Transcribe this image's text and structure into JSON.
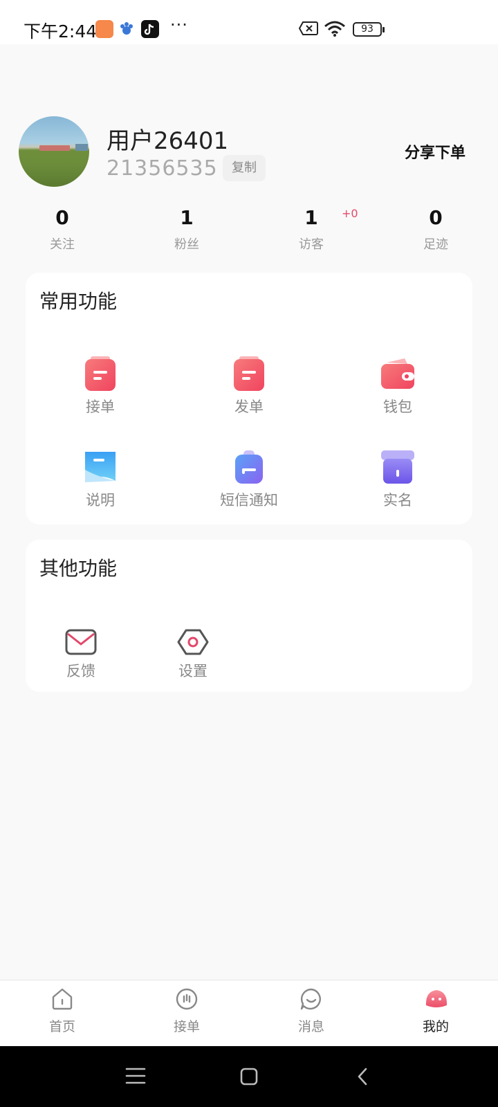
{
  "status_bar": {
    "time": "下午2:44",
    "battery": "93",
    "more_icon": "···"
  },
  "profile": {
    "username": "用户26401",
    "user_id": "21356535",
    "copy_label": "复制",
    "share_order_label": "分享下单"
  },
  "stats": [
    {
      "value": "0",
      "label": "关注"
    },
    {
      "value": "1",
      "label": "粉丝"
    },
    {
      "value": "1",
      "label": "访客",
      "badge": "+0"
    },
    {
      "value": "0",
      "label": "足迹"
    }
  ],
  "common_functions": {
    "title": "常用功能",
    "items": [
      {
        "label": "接单",
        "icon": "order-receive-icon"
      },
      {
        "label": "发单",
        "icon": "order-publish-icon"
      },
      {
        "label": "钱包",
        "icon": "wallet-icon"
      },
      {
        "label": "说明",
        "icon": "instruction-icon"
      },
      {
        "label": "短信通知",
        "icon": "sms-notify-icon"
      },
      {
        "label": "实名",
        "icon": "real-name-icon"
      }
    ]
  },
  "other_functions": {
    "title": "其他功能",
    "items": [
      {
        "label": "反馈",
        "icon": "mail-icon"
      },
      {
        "label": "设置",
        "icon": "settings-icon"
      }
    ]
  },
  "bottom_nav": {
    "items": [
      {
        "label": "首页",
        "icon": "home-icon"
      },
      {
        "label": "接单",
        "icon": "order-icon"
      },
      {
        "label": "消息",
        "icon": "message-icon"
      },
      {
        "label": "我的",
        "icon": "mine-icon",
        "active": true
      }
    ]
  },
  "colors": {
    "accent_red": "#f4606a",
    "accent_blue": "#3fa9f5",
    "accent_purple": "#7a6cf0",
    "badge_pink": "#e2486a"
  }
}
